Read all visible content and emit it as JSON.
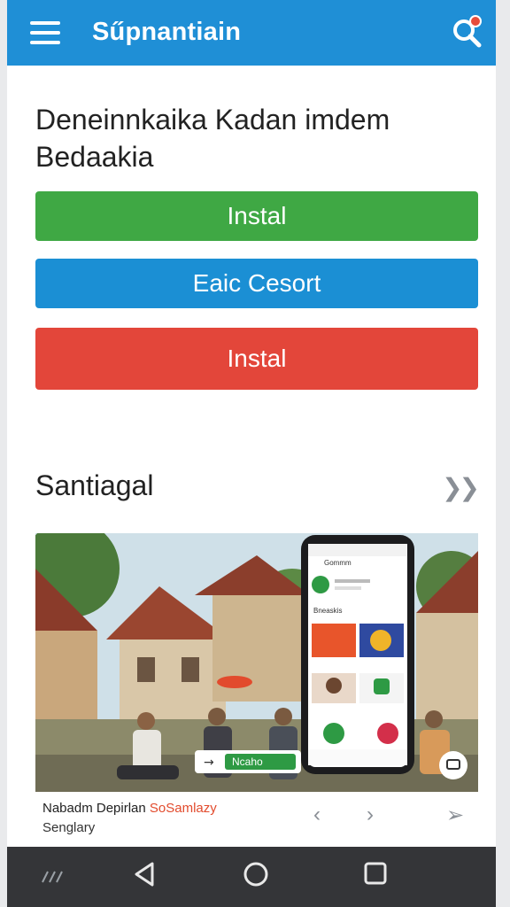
{
  "appbar": {
    "title": "Sűpnantiain"
  },
  "main": {
    "heading_line1": "Deneinnkaika Kadan imdem",
    "heading_line2": "Bedaakia",
    "buttons": [
      {
        "label": "Instal",
        "color": "#3fa844"
      },
      {
        "label": "Eaic Cesort",
        "color": "#1b8fd4"
      },
      {
        "label": "Instal",
        "color": "#e3463a"
      }
    ],
    "section_title": "Santiagal",
    "hero": {
      "phone_header": "Gommm",
      "phone_label": "Bneaskis",
      "overlay_label": "Ncaho"
    },
    "caption": {
      "prefix": "Nabadm Depirlan ",
      "highlight": "SoSamlazy",
      "line2": "Senglary"
    }
  },
  "colors": {
    "appbar": "#1f8fd6",
    "accent_red": "#e3463a",
    "accent_green": "#3fa844"
  }
}
